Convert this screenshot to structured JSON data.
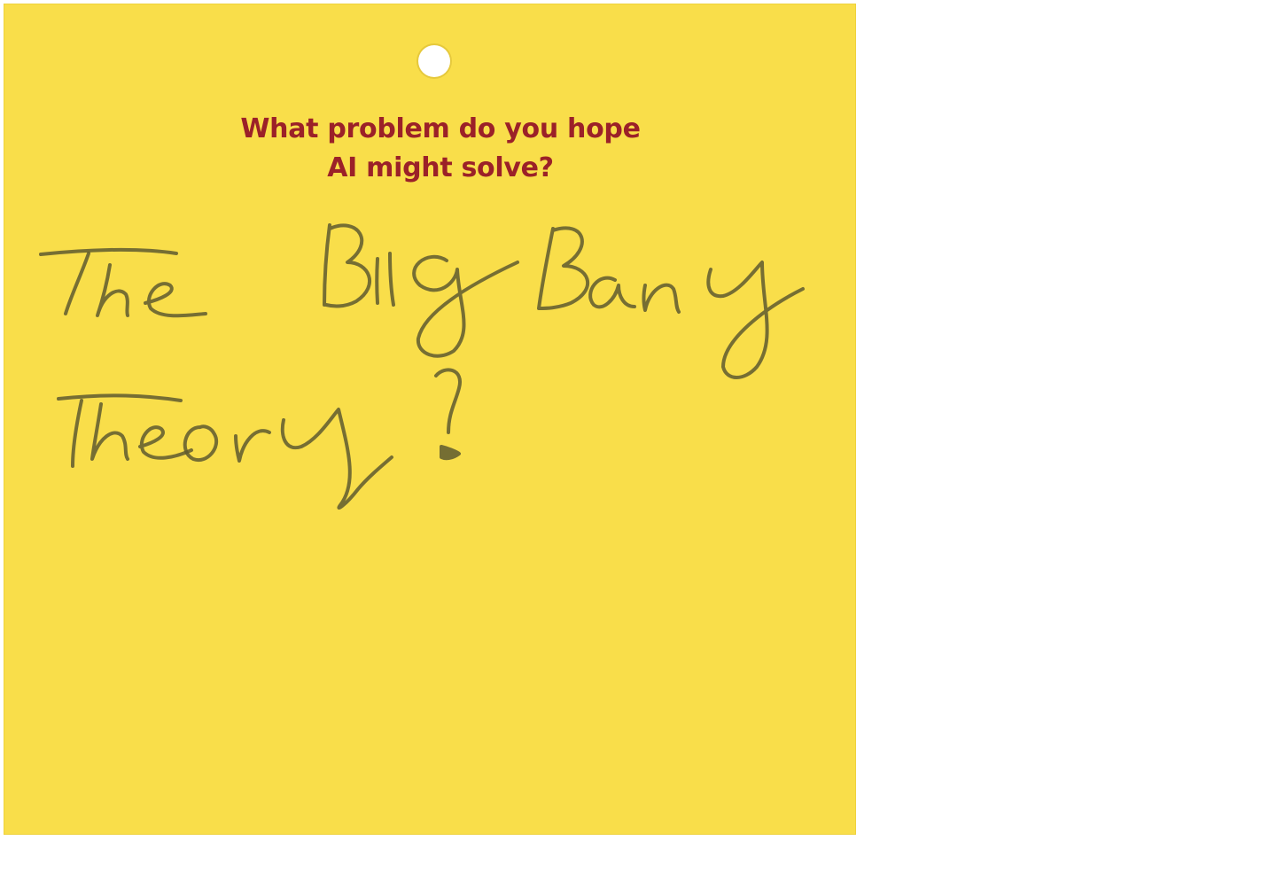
{
  "card": {
    "prompt_line1": "What problem do you hope",
    "prompt_line2": "AI might solve?",
    "answer": "The Big Bang Theory?",
    "background_color": "#f9de4a",
    "prompt_color": "#9b2128"
  }
}
